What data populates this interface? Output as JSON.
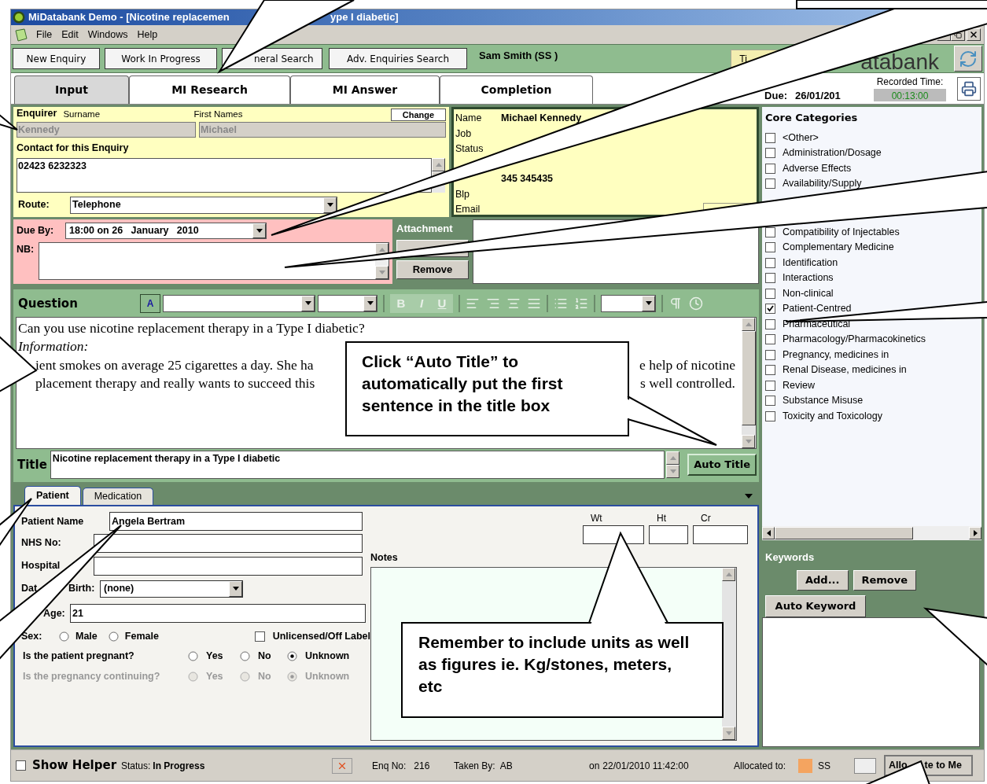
{
  "window": {
    "title_left": "MiDatabank Demo - [Nicotine replacemen",
    "title_right": "ype I diabetic]"
  },
  "menu": [
    "File",
    "Edit",
    "Windows",
    "Help"
  ],
  "toolbar": {
    "buttons": [
      "New Enquiry",
      "Work In Progress",
      "neral Search",
      "Adv. Enquiries Search"
    ],
    "user": "Sam Smith (SS )",
    "timer_fragment": "Ti",
    "logo": "atabank"
  },
  "tabs": [
    {
      "label": "Input",
      "selected": true
    },
    {
      "label": "MI Research",
      "selected": false
    },
    {
      "label": "MI Answer",
      "selected": false
    },
    {
      "label": "Completion",
      "selected": false
    }
  ],
  "due_header": {
    "label": "Due:",
    "value": "26/01/201",
    "recorded_label": "Recorded Time:",
    "recorded_value": "00:13:00"
  },
  "enquirer": {
    "heading": "Enquirer",
    "surname_label": "Surname",
    "surname": "Kennedy",
    "first_label": "First Names",
    "first": "Michael",
    "change": "Change",
    "contact_label": "Contact for this Enquiry",
    "contact": "02423 6232323",
    "route_label": "Route:",
    "route": "Telephone"
  },
  "contact_card": {
    "fields_top": [
      {
        "label": "Name",
        "value": "Michael Kennedy"
      },
      {
        "label": "Job"
      },
      {
        "label": "Status"
      }
    ],
    "fields_bottom": [
      {
        "value": "345 345435"
      },
      {
        "label": "Blp"
      },
      {
        "label": "Email"
      }
    ]
  },
  "due": {
    "label": "Due By:",
    "value": "18:00 on 26   January   2010",
    "nb_label": "NB:"
  },
  "attachment": {
    "heading": "Attachment",
    "remove": "Remove"
  },
  "question": {
    "heading": "Question",
    "font_button": "A",
    "format_buttons": [
      "B",
      "I",
      "U"
    ],
    "line1": "Can you use nicotine replacement therapy in a Type I diabetic?",
    "line2": "Information:",
    "fragments": [
      {
        "left": "ient smokes on average 25 cigarettes a day. She ha",
        "right": "e help of nicotine"
      },
      {
        "left": "placement therapy and really wants to succeed this",
        "right": "s well controlled."
      }
    ],
    "title_label": "Title",
    "title_value": "Nicotine replacement therapy in a Type I diabetic",
    "auto_title": "Auto Title"
  },
  "patient_tabs": [
    {
      "label": "Patient",
      "selected": true
    },
    {
      "label": "Medication",
      "selected": false
    }
  ],
  "patient": {
    "name_label": "Patient Name",
    "name": "Angela Bertram",
    "nhs_label": "NHS No:",
    "hospital_label": "Hospital",
    "dob_label_parts": [
      "Dat",
      "Birth:"
    ],
    "dob": "(none)",
    "age_label": "Age:",
    "age": "21",
    "sex_label": "Sex:",
    "sex_options": [
      {
        "label": "Male",
        "selected": false
      },
      {
        "label": "Female",
        "selected": false
      }
    ],
    "unlicensed": {
      "label": "Unlicensed/Off Label",
      "checked": false
    },
    "questions": [
      {
        "question": "Is the patient pregnant?",
        "disabled": false,
        "options": [
          {
            "label": "Yes",
            "selected": false
          },
          {
            "label": "No",
            "selected": false
          },
          {
            "label": "Unknown",
            "selected": true
          }
        ]
      },
      {
        "question": "Is the pregnancy continuing?",
        "disabled": true,
        "options": [
          {
            "label": "Yes",
            "selected": false
          },
          {
            "label": "No",
            "selected": false
          },
          {
            "label": "Unknown",
            "selected": true
          }
        ]
      }
    ],
    "measures": [
      "Wt",
      "Ht",
      "Cr"
    ],
    "notes_label": "Notes"
  },
  "categories": {
    "heading": "Core Categories",
    "top": [
      {
        "label": "<Other>",
        "checked": false
      },
      {
        "label": "Administration/Dosage",
        "checked": false
      },
      {
        "label": "Adverse Effects",
        "checked": false
      },
      {
        "label": "Availability/Supply",
        "checked": false
      }
    ],
    "bottom": [
      {
        "label": "Compatibility of Injectables",
        "checked": false
      },
      {
        "label": "Complementary Medicine",
        "checked": false
      },
      {
        "label": "Identification",
        "checked": false
      },
      {
        "label": "Interactions",
        "checked": false
      },
      {
        "label": "Non-clinical",
        "checked": false
      },
      {
        "label": "Patient-Centred",
        "checked": true
      },
      {
        "label": "Pharmaceutical",
        "checked": false
      },
      {
        "label": "Pharmacology/Pharmacokinetics",
        "checked": false
      },
      {
        "label": "Pregnancy, medicines in",
        "checked": false
      },
      {
        "label": "Renal Disease, medicines in",
        "checked": false
      },
      {
        "label": "Review",
        "checked": false
      },
      {
        "label": "Substance Misuse",
        "checked": false
      },
      {
        "label": "Toxicity and Toxicology",
        "checked": false
      }
    ]
  },
  "keywords": {
    "heading": "Keywords",
    "buttons": [
      "Add...",
      "Remove"
    ],
    "auto": "Auto Keyword"
  },
  "status_bar": {
    "show_helper": {
      "label": "Show Helper",
      "checked": false
    },
    "status_label": "Status:",
    "status": "In Progress",
    "enq_label": "Enq No:",
    "enq": "216",
    "taken_label": "Taken By:",
    "taken": "AB",
    "on_label": "on",
    "on": "22/01/2010 11:42:00",
    "allocated_label": "Allocated to:",
    "allocated": {
      "color": "#f4a460",
      "text": "SS"
    },
    "allocate_left": "Allo",
    "allocate_right": "te to Me"
  },
  "callouts": [
    {
      "text": "Click “Auto Title” to automatically put the first sentence in the title box"
    },
    {
      "text": "Remember to include units as well as figures ie. Kg/stones, meters, etc"
    }
  ]
}
